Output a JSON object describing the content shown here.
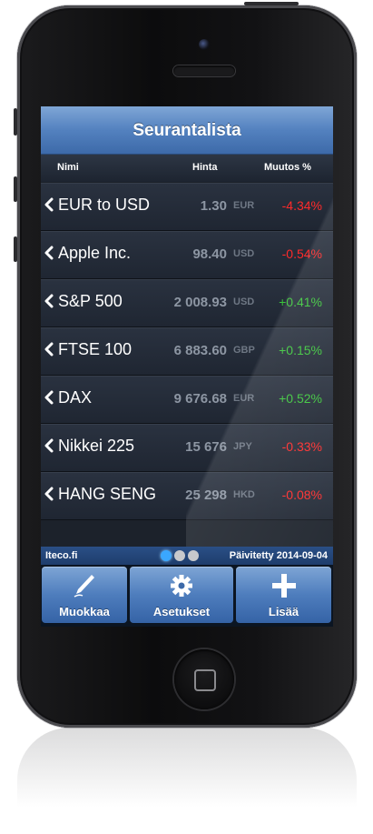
{
  "nav": {
    "title": "Seurantalista"
  },
  "columns": {
    "name": "Nimi",
    "price": "Hinta",
    "change": "Muutos %"
  },
  "colors": {
    "positive": "#3bc43b",
    "negative": "#ff2a2a",
    "accent": "#4e7dbd"
  },
  "rows": [
    {
      "name": "EUR to USD",
      "price": "1.30",
      "currency": "EUR",
      "change": "-4.34%",
      "direction": "down"
    },
    {
      "name": "Apple Inc.",
      "price": "98.40",
      "currency": "USD",
      "change": "-0.54%",
      "direction": "down"
    },
    {
      "name": "S&P 500",
      "price": "2 008.93",
      "currency": "USD",
      "change": "+0.41%",
      "direction": "up"
    },
    {
      "name": "FTSE 100",
      "price": "6 883.60",
      "currency": "GBP",
      "change": "+0.15%",
      "direction": "up"
    },
    {
      "name": "DAX",
      "price": "9 676.68",
      "currency": "EUR",
      "change": "+0.52%",
      "direction": "up"
    },
    {
      "name": "Nikkei 225",
      "price": "15 676",
      "currency": "JPY",
      "change": "-0.33%",
      "direction": "down"
    },
    {
      "name": "HANG SENG",
      "price": "25 298",
      "currency": "HKD",
      "change": "-0.08%",
      "direction": "down"
    }
  ],
  "status": {
    "site": "Iteco.fi",
    "updated": "Päivitetty 2014-09-04",
    "pages": 3,
    "active_page": 1
  },
  "toolbar": {
    "edit": {
      "label": "Muokkaa",
      "icon": "pen-icon"
    },
    "settings": {
      "label": "Asetukset",
      "icon": "gear-icon"
    },
    "add": {
      "label": "Lisää",
      "icon": "plus-icon"
    }
  }
}
